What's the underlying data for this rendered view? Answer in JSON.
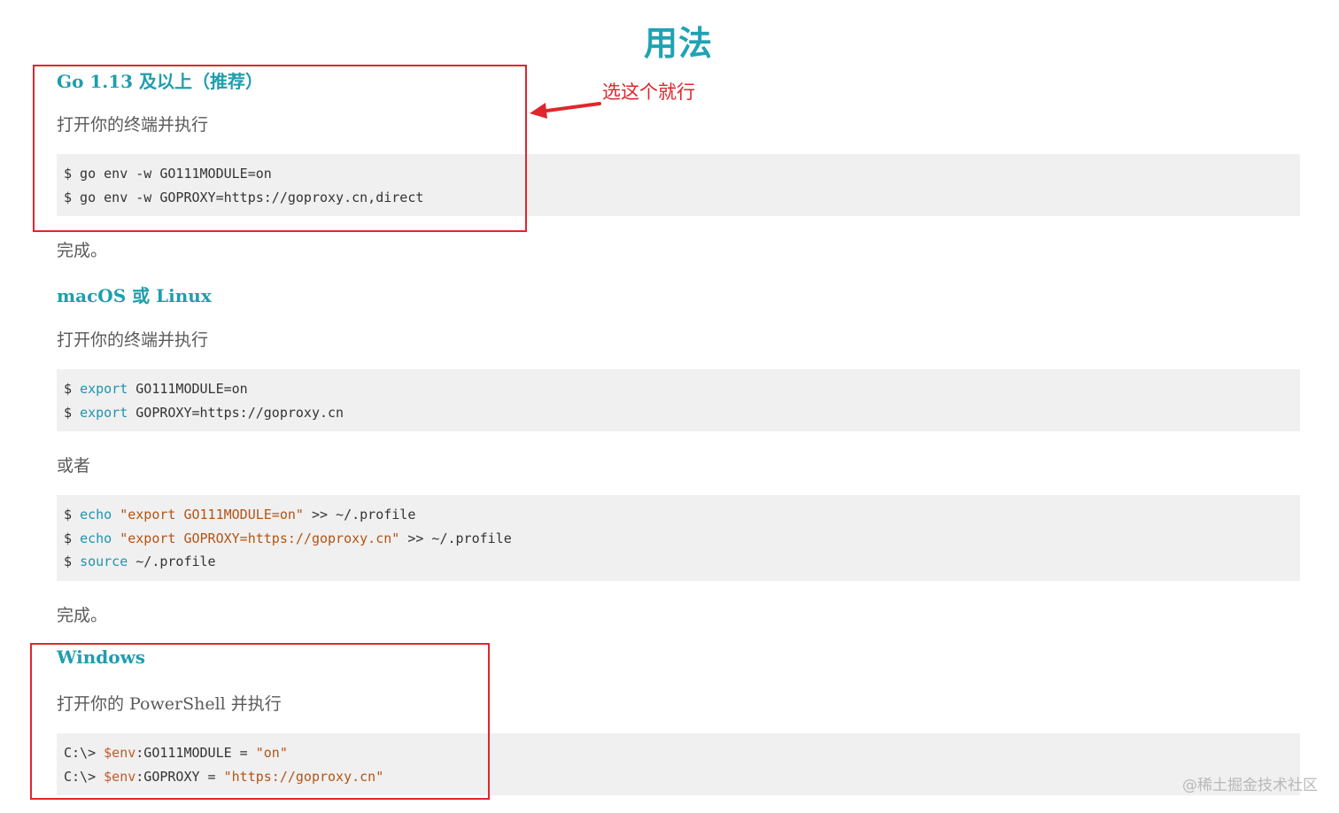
{
  "title": "用法",
  "annotation": "选这个就行",
  "watermark": "@稀土掘金技术社区",
  "sections": [
    {
      "heading": "Go 1.13 及以上（推荐）",
      "intro": "打开你的终端并执行",
      "code": [
        "$ go env -w GO111MODULE=on",
        "$ go env -w GOPROXY=https://goproxy.cn,direct"
      ],
      "outro": "完成。"
    },
    {
      "heading": "macOS 或 Linux",
      "intro": "打开你的终端并执行",
      "code": [
        {
          "prompt": "$ ",
          "kw": "export",
          "rest": " GO111MODULE=on"
        },
        {
          "prompt": "$ ",
          "kw": "export",
          "rest": " GOPROXY=https://goproxy.cn"
        }
      ],
      "middle": "或者",
      "code2": [
        {
          "prompt": "$ ",
          "kw": "echo",
          "str": " \"export GO111MODULE=on\"",
          "rest": " >> ~/.profile"
        },
        {
          "prompt": "$ ",
          "kw": "echo",
          "str": " \"export GOPROXY=https://goproxy.cn\"",
          "rest": " >> ~/.profile"
        },
        {
          "prompt": "$ ",
          "kw": "source",
          "str": "",
          "rest": " ~/.profile"
        }
      ],
      "outro": "完成。"
    },
    {
      "heading": "Windows",
      "intro": "打开你的 PowerShell 并执行",
      "code": [
        {
          "prompt": "C:\\> ",
          "var": "$env",
          "mid": ":GO111MODULE = ",
          "str": "\"on\""
        },
        {
          "prompt": "C:\\> ",
          "var": "$env",
          "mid": ":GOPROXY = ",
          "str": "\"https://goproxy.cn\""
        }
      ]
    }
  ],
  "colors": {
    "accent": "#1fa3b3",
    "highlight_box": "#e0262d",
    "code_bg": "#f0f0f0"
  }
}
